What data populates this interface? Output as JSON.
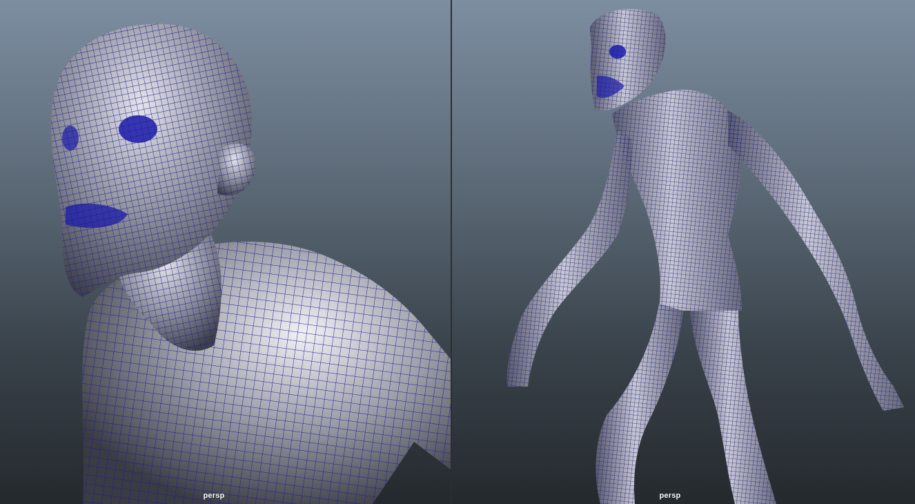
{
  "viewports": [
    {
      "id": "left",
      "camera_label": "persp"
    },
    {
      "id": "right",
      "camera_label": "persp"
    }
  ],
  "colors": {
    "wire": "#1a1aa8",
    "skin_light": "#e9e9ec",
    "skin_dark": "#3b3d44"
  }
}
